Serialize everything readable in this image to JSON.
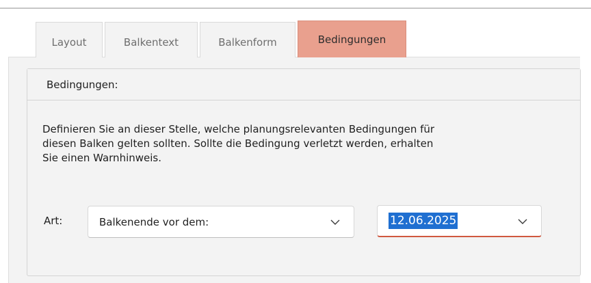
{
  "tabs": [
    {
      "label": "Layout",
      "active": false
    },
    {
      "label": "Balkentext",
      "active": false
    },
    {
      "label": "Balkenform",
      "active": false
    },
    {
      "label": "Bedingungen",
      "active": true
    }
  ],
  "group": {
    "title": "Bedingungen:"
  },
  "description": {
    "line1": "Definieren Sie an dieser Stelle, welche planungsrelevanten Bedingungen für",
    "line2": "diesen Balken gelten sollten. Sollte die Bedingung verletzt werden, erhalten",
    "line3": "Sie einen Warnhinweis."
  },
  "form": {
    "art_label": "Art:",
    "type_value": "Balkenende vor dem:",
    "date_value": "12.06.2025"
  },
  "icons": {
    "dropdown": "chevron-down-icon"
  },
  "colors": {
    "active_tab": "#e9a08e",
    "date_underline": "#d0583f",
    "selection": "#1f6fd1"
  }
}
